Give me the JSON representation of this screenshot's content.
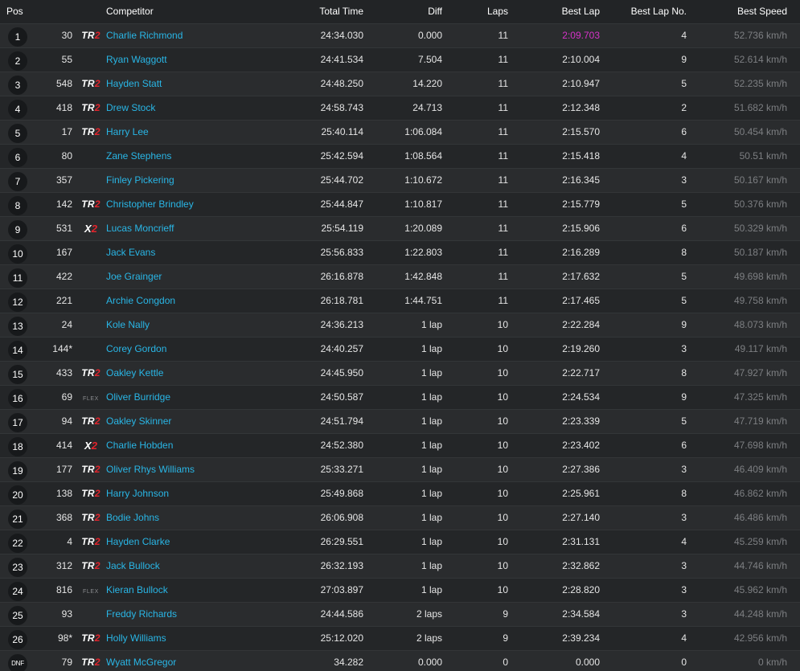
{
  "columns": {
    "pos": "Pos",
    "competitor": "Competitor",
    "total_time": "Total Time",
    "diff": "Diff",
    "laps": "Laps",
    "best_lap": "Best Lap",
    "best_lap_no": "Best Lap No.",
    "best_speed": "Best Speed"
  },
  "colors": {
    "link": "#29b6e6",
    "fastest_lap": "#d633c9",
    "class_accent": "#e2242c",
    "muted_speed": "#7d7f82"
  },
  "rows": [
    {
      "pos": "1",
      "num": "30",
      "cls": "tr2",
      "name": "Charlie Richmond",
      "total": "24:34.030",
      "diff": "0.000",
      "laps": "11",
      "best": "2:09.703",
      "fastest": true,
      "bestno": "4",
      "speed": "52.736 km/h"
    },
    {
      "pos": "2",
      "num": "55",
      "cls": "",
      "name": "Ryan Waggott",
      "total": "24:41.534",
      "diff": "7.504",
      "laps": "11",
      "best": "2:10.004",
      "bestno": "9",
      "speed": "52.614 km/h"
    },
    {
      "pos": "3",
      "num": "548",
      "cls": "tr2",
      "name": "Hayden Statt",
      "total": "24:48.250",
      "diff": "14.220",
      "laps": "11",
      "best": "2:10.947",
      "bestno": "5",
      "speed": "52.235 km/h"
    },
    {
      "pos": "4",
      "num": "418",
      "cls": "tr2",
      "name": "Drew Stock",
      "total": "24:58.743",
      "diff": "24.713",
      "laps": "11",
      "best": "2:12.348",
      "bestno": "2",
      "speed": "51.682 km/h"
    },
    {
      "pos": "5",
      "num": "17",
      "cls": "tr2",
      "name": "Harry Lee",
      "total": "25:40.114",
      "diff": "1:06.084",
      "laps": "11",
      "best": "2:15.570",
      "bestno": "6",
      "speed": "50.454 km/h"
    },
    {
      "pos": "6",
      "num": "80",
      "cls": "",
      "name": "Zane Stephens",
      "total": "25:42.594",
      "diff": "1:08.564",
      "laps": "11",
      "best": "2:15.418",
      "bestno": "4",
      "speed": "50.51 km/h"
    },
    {
      "pos": "7",
      "num": "357",
      "cls": "",
      "name": "Finley Pickering",
      "total": "25:44.702",
      "diff": "1:10.672",
      "laps": "11",
      "best": "2:16.345",
      "bestno": "3",
      "speed": "50.167 km/h"
    },
    {
      "pos": "8",
      "num": "142",
      "cls": "tr2",
      "name": "Christopher Brindley",
      "total": "25:44.847",
      "diff": "1:10.817",
      "laps": "11",
      "best": "2:15.779",
      "bestno": "5",
      "speed": "50.376 km/h"
    },
    {
      "pos": "9",
      "num": "531",
      "cls": "x2",
      "name": "Lucas Moncrieff",
      "total": "25:54.119",
      "diff": "1:20.089",
      "laps": "11",
      "best": "2:15.906",
      "bestno": "6",
      "speed": "50.329 km/h"
    },
    {
      "pos": "10",
      "num": "167",
      "cls": "",
      "name": "Jack Evans",
      "total": "25:56.833",
      "diff": "1:22.803",
      "laps": "11",
      "best": "2:16.289",
      "bestno": "8",
      "speed": "50.187 km/h"
    },
    {
      "pos": "11",
      "num": "422",
      "cls": "",
      "name": "Joe Grainger",
      "total": "26:16.878",
      "diff": "1:42.848",
      "laps": "11",
      "best": "2:17.632",
      "bestno": "5",
      "speed": "49.698 km/h"
    },
    {
      "pos": "12",
      "num": "221",
      "cls": "",
      "name": "Archie Congdon",
      "total": "26:18.781",
      "diff": "1:44.751",
      "laps": "11",
      "best": "2:17.465",
      "bestno": "5",
      "speed": "49.758 km/h"
    },
    {
      "pos": "13",
      "num": "24",
      "cls": "",
      "name": "Kole Nally",
      "total": "24:36.213",
      "diff": "1 lap",
      "laps": "10",
      "best": "2:22.284",
      "bestno": "9",
      "speed": "48.073 km/h"
    },
    {
      "pos": "14",
      "num": "144*",
      "cls": "",
      "name": "Corey Gordon",
      "total": "24:40.257",
      "diff": "1 lap",
      "laps": "10",
      "best": "2:19.260",
      "bestno": "3",
      "speed": "49.117 km/h"
    },
    {
      "pos": "15",
      "num": "433",
      "cls": "tr2",
      "name": "Oakley Kettle",
      "total": "24:45.950",
      "diff": "1 lap",
      "laps": "10",
      "best": "2:22.717",
      "bestno": "8",
      "speed": "47.927 km/h"
    },
    {
      "pos": "16",
      "num": "69",
      "cls": "flex",
      "name": "Oliver Burridge",
      "total": "24:50.587",
      "diff": "1 lap",
      "laps": "10",
      "best": "2:24.534",
      "bestno": "9",
      "speed": "47.325 km/h"
    },
    {
      "pos": "17",
      "num": "94",
      "cls": "tr2",
      "name": "Oakley Skinner",
      "total": "24:51.794",
      "diff": "1 lap",
      "laps": "10",
      "best": "2:23.339",
      "bestno": "5",
      "speed": "47.719 km/h"
    },
    {
      "pos": "18",
      "num": "414",
      "cls": "x2",
      "name": "Charlie Hobden",
      "total": "24:52.380",
      "diff": "1 lap",
      "laps": "10",
      "best": "2:23.402",
      "bestno": "6",
      "speed": "47.698 km/h"
    },
    {
      "pos": "19",
      "num": "177",
      "cls": "tr2",
      "name": "Oliver Rhys Williams",
      "total": "25:33.271",
      "diff": "1 lap",
      "laps": "10",
      "best": "2:27.386",
      "bestno": "3",
      "speed": "46.409 km/h"
    },
    {
      "pos": "20",
      "num": "138",
      "cls": "tr2",
      "name": "Harry Johnson",
      "total": "25:49.868",
      "diff": "1 lap",
      "laps": "10",
      "best": "2:25.961",
      "bestno": "8",
      "speed": "46.862 km/h"
    },
    {
      "pos": "21",
      "num": "368",
      "cls": "tr2",
      "name": "Bodie Johns",
      "total": "26:06.908",
      "diff": "1 lap",
      "laps": "10",
      "best": "2:27.140",
      "bestno": "3",
      "speed": "46.486 km/h"
    },
    {
      "pos": "22",
      "num": "4",
      "cls": "tr2",
      "name": "Hayden Clarke",
      "total": "26:29.551",
      "diff": "1 lap",
      "laps": "10",
      "best": "2:31.131",
      "bestno": "4",
      "speed": "45.259 km/h"
    },
    {
      "pos": "23",
      "num": "312",
      "cls": "tr2",
      "name": "Jack Bullock",
      "total": "26:32.193",
      "diff": "1 lap",
      "laps": "10",
      "best": "2:32.862",
      "bestno": "3",
      "speed": "44.746 km/h"
    },
    {
      "pos": "24",
      "num": "816",
      "cls": "flex",
      "name": "Kieran Bullock",
      "total": "27:03.897",
      "diff": "1 lap",
      "laps": "10",
      "best": "2:28.820",
      "bestno": "3",
      "speed": "45.962 km/h"
    },
    {
      "pos": "25",
      "num": "93",
      "cls": "",
      "name": "Freddy Richards",
      "total": "24:44.586",
      "diff": "2 laps",
      "laps": "9",
      "best": "2:34.584",
      "bestno": "3",
      "speed": "44.248 km/h"
    },
    {
      "pos": "26",
      "num": "98*",
      "cls": "tr2",
      "name": "Holly Williams",
      "total": "25:12.020",
      "diff": "2 laps",
      "laps": "9",
      "best": "2:39.234",
      "bestno": "4",
      "speed": "42.956 km/h"
    },
    {
      "pos": "DNF",
      "num": "79",
      "cls": "tr2",
      "name": "Wyatt McGregor",
      "total": "34.282",
      "diff": "0.000",
      "laps": "0",
      "best": "0.000",
      "bestno": "0",
      "speed": "0 km/h"
    }
  ],
  "class_labels": {
    "tr2": {
      "main": "TR",
      "accent": "2"
    },
    "x2": {
      "main": "X",
      "accent": "2"
    },
    "flex": {
      "main": "FLEX",
      "accent": ""
    }
  }
}
